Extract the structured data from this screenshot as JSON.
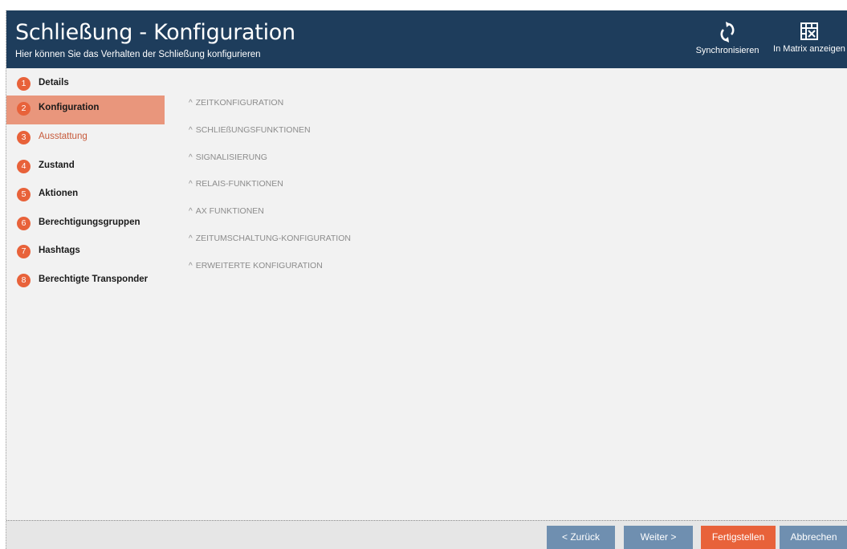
{
  "header": {
    "title": "Schließung - Konfiguration",
    "subtitle": "Hier können Sie das Verhalten der Schließung konfigurieren",
    "sync_label": "Synchronisieren",
    "matrix_label": "In Matrix anzeigen"
  },
  "steps": [
    {
      "num": "1",
      "label": "Details"
    },
    {
      "num": "2",
      "label": "Konfiguration"
    },
    {
      "num": "3",
      "label": "Ausstattung"
    },
    {
      "num": "4",
      "label": "Zustand"
    },
    {
      "num": "5",
      "label": "Aktionen"
    },
    {
      "num": "6",
      "label": "Berechtigungsgruppen"
    },
    {
      "num": "7",
      "label": "Hashtags"
    },
    {
      "num": "8",
      "label": "Berechtigte Transponder"
    }
  ],
  "sections": [
    {
      "label": "ZEITKONFIGURATION"
    },
    {
      "label": "SCHLIEßUNGSFUNKTIONEN"
    },
    {
      "label": "SIGNALISIERUNG"
    },
    {
      "label": "RELAIS-FUNKTIONEN"
    },
    {
      "label": "AX FUNKTIONEN"
    },
    {
      "label": "ZEITUMSCHALTUNG-KONFIGURATION"
    },
    {
      "label": "ERWEITERTE KONFIGURATION"
    }
  ],
  "footer": {
    "back_label": "< Zurück",
    "next_label": "Weiter >",
    "finish_label": "Fertigstellen",
    "cancel_label": "Abbrechen"
  },
  "colors": {
    "header_bg": "#1e3d5c",
    "accent": "#e8623a",
    "active_step": "#e9967c",
    "button_blue": "#6f8fb0"
  },
  "icons": {
    "sync": "sync-icon",
    "matrix": "matrix-icon",
    "section_chevron": "chevron-up-icon"
  }
}
